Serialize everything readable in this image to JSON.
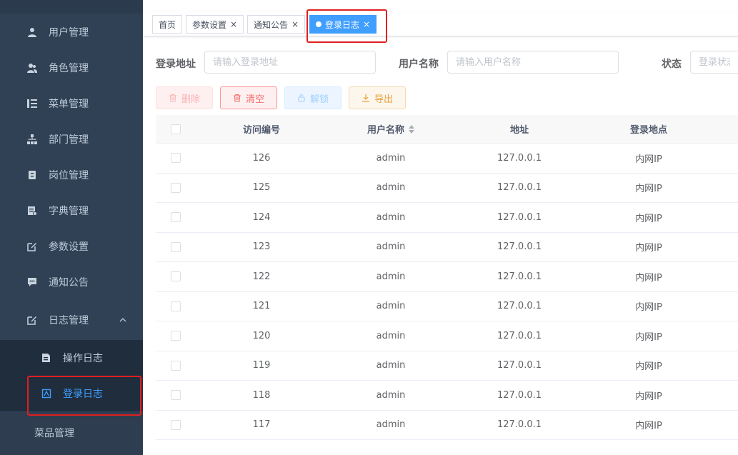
{
  "sidebar": {
    "items": [
      {
        "label": "用户管理",
        "icon": "user-icon"
      },
      {
        "label": "角色管理",
        "icon": "role-icon"
      },
      {
        "label": "菜单管理",
        "icon": "menu-tree-icon"
      },
      {
        "label": "部门管理",
        "icon": "org-tree-icon"
      },
      {
        "label": "岗位管理",
        "icon": "post-icon"
      },
      {
        "label": "字典管理",
        "icon": "dict-icon"
      },
      {
        "label": "参数设置",
        "icon": "edit-icon"
      },
      {
        "label": "通知公告",
        "icon": "message-icon"
      },
      {
        "label": "日志管理",
        "icon": "log-icon"
      }
    ],
    "sub_items": [
      {
        "label": "操作日志",
        "icon": "form-icon"
      },
      {
        "label": "登录日志",
        "icon": "login-log-icon"
      }
    ],
    "bottom_item": "菜品管理"
  },
  "tags": {
    "home": "首页",
    "params": "参数设置",
    "notice": "通知公告",
    "loginlog": "登录日志",
    "close": "×"
  },
  "search": {
    "addr_label": "登录地址",
    "addr_placeholder": "请输入登录地址",
    "user_label": "用户名称",
    "user_placeholder": "请输入用户名称",
    "status_label": "状态",
    "status_placeholder": "登录状态"
  },
  "toolbar": {
    "delete_label": "删除",
    "clear_label": "清空",
    "unlock_label": "解锁",
    "export_label": "导出"
  },
  "table": {
    "columns": [
      "访问编号",
      "用户名称",
      "地址",
      "登录地点"
    ],
    "rows": [
      {
        "id": "126",
        "user": "admin",
        "addr": "127.0.0.1",
        "loc": "内网IP"
      },
      {
        "id": "125",
        "user": "admin",
        "addr": "127.0.0.1",
        "loc": "内网IP"
      },
      {
        "id": "124",
        "user": "admin",
        "addr": "127.0.0.1",
        "loc": "内网IP"
      },
      {
        "id": "123",
        "user": "admin",
        "addr": "127.0.0.1",
        "loc": "内网IP"
      },
      {
        "id": "122",
        "user": "admin",
        "addr": "127.0.0.1",
        "loc": "内网IP"
      },
      {
        "id": "121",
        "user": "admin",
        "addr": "127.0.0.1",
        "loc": "内网IP"
      },
      {
        "id": "120",
        "user": "admin",
        "addr": "127.0.0.1",
        "loc": "内网IP"
      },
      {
        "id": "119",
        "user": "admin",
        "addr": "127.0.0.1",
        "loc": "内网IP"
      },
      {
        "id": "118",
        "user": "admin",
        "addr": "127.0.0.1",
        "loc": "内网IP"
      },
      {
        "id": "117",
        "user": "admin",
        "addr": "127.0.0.1",
        "loc": "内网IP"
      }
    ]
  },
  "colors": {
    "sidebar_bg": "#304156",
    "accent": "#409eff",
    "highlight": "#e02020"
  }
}
